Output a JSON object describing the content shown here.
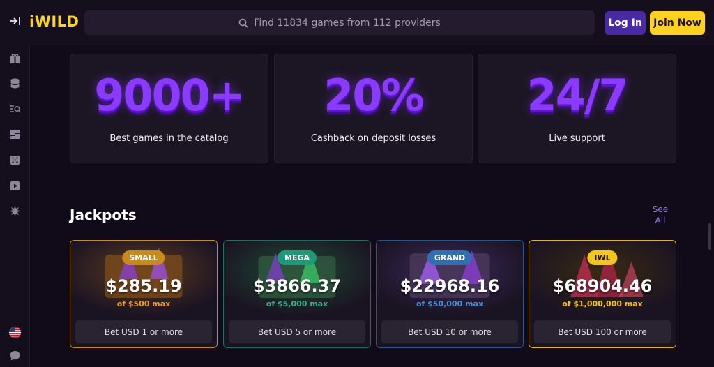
{
  "header": {
    "logo": "iWILD",
    "search_placeholder": "Find 11834 games from 112 providers",
    "login_label": "Log In",
    "join_label": "Join Now"
  },
  "sidebar": {
    "icons": [
      "gift-icon",
      "coins-icon",
      "search-list-icon",
      "dashboard-icon",
      "dice-icon",
      "play-icon",
      "burst-icon"
    ],
    "language_icon": "us-flag-icon",
    "chat_icon": "chat-icon"
  },
  "features": [
    {
      "value": "9000+",
      "caption": "Best games in the catalog"
    },
    {
      "value": "20%",
      "caption": "Cashback on deposit losses"
    },
    {
      "value": "24/7",
      "caption": "Live support"
    }
  ],
  "jackpots": {
    "title": "Jackpots",
    "see_all": "See All",
    "items": [
      {
        "badge": "SMALL",
        "amount": "$285.19",
        "max": "of $500 max",
        "button": "Bet USD 1 or more",
        "accent": "#c98a1c",
        "border": "#c98a1c",
        "max_color": "#e59a2a"
      },
      {
        "badge": "MEGA",
        "amount": "$3866.37",
        "max": "of $5,000 max",
        "button": "Bet USD 5 or more",
        "accent": "#1f9a78",
        "border": "#1e6f5c",
        "max_color": "#3cae86"
      },
      {
        "badge": "GRAND",
        "amount": "$22968.16",
        "max": "of $50,000 max",
        "button": "Bet USD 10 or more",
        "accent": "#2f6fb3",
        "border": "#2a5790",
        "max_color": "#4f8fd6"
      },
      {
        "badge": "IWL",
        "amount": "$68904.46",
        "max": "of $1,000,000 max",
        "button": "Bet USD 100 or more",
        "accent": "#f5c518",
        "border": "#e3b21c",
        "max_color": "#f3c21a"
      }
    ]
  }
}
